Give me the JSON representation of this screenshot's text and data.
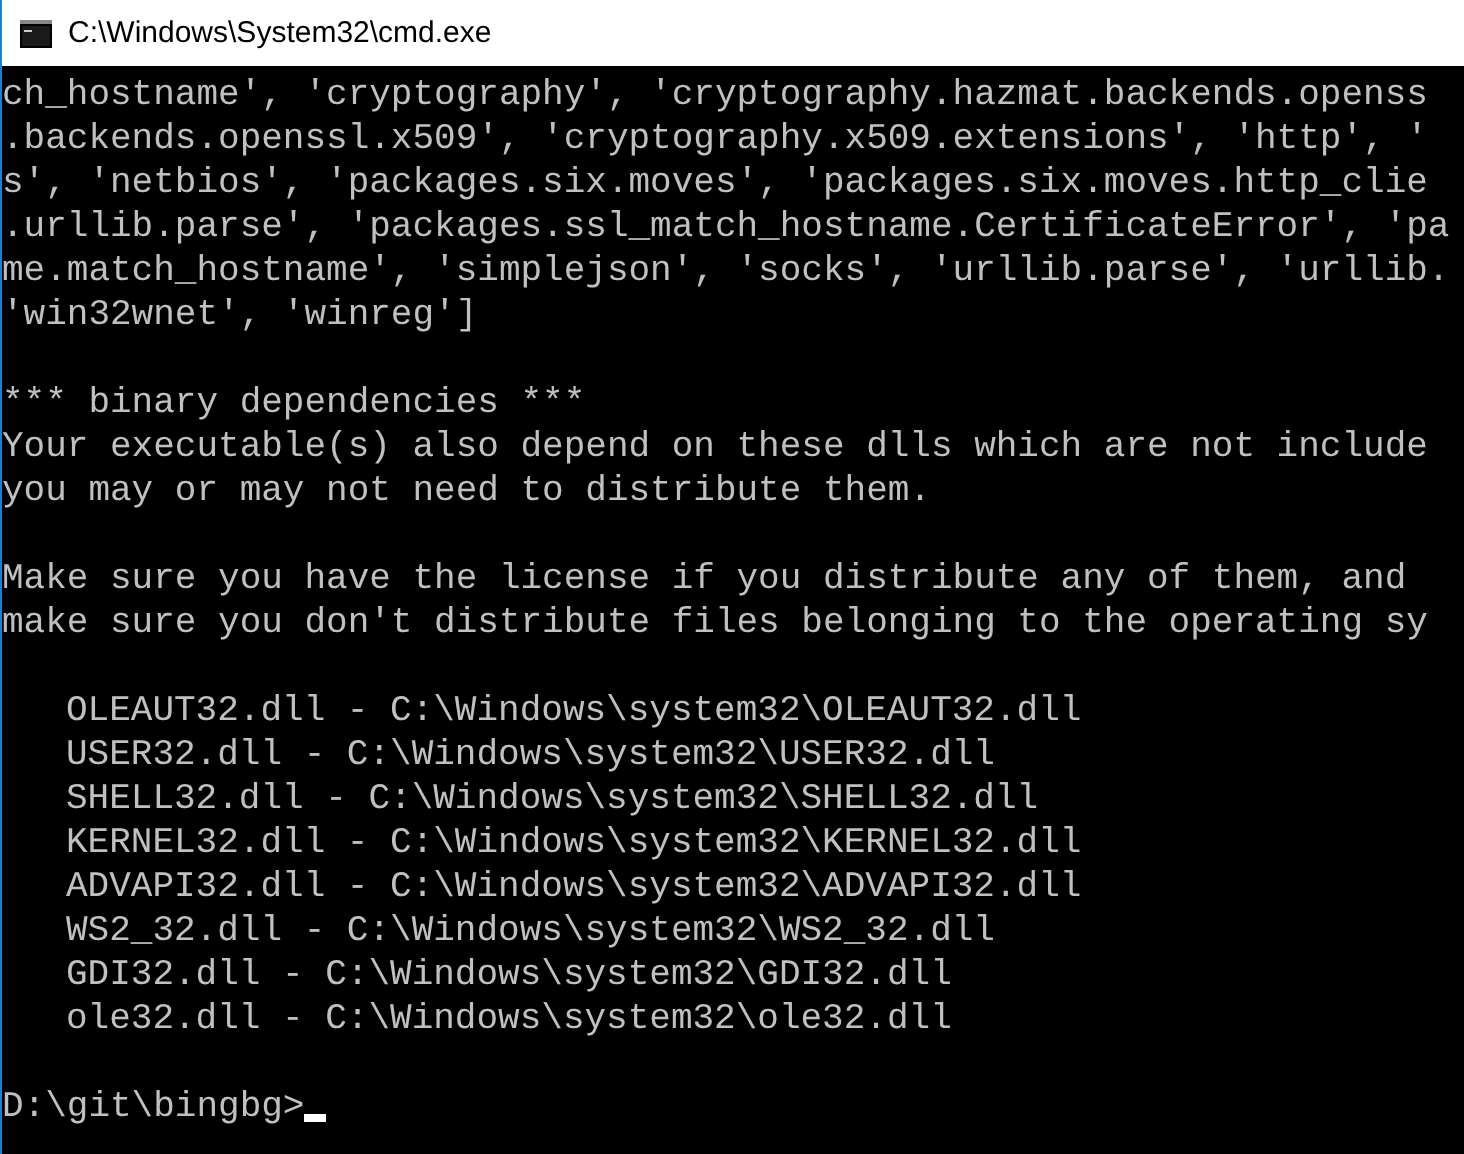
{
  "window": {
    "title": "C:\\Windows\\System32\\cmd.exe"
  },
  "console": {
    "blocks": [
      {
        "indent": false,
        "lines": [
          "ch_hostname', 'cryptography', 'cryptography.hazmat.backends.openss",
          ".backends.openssl.x509', 'cryptography.x509.extensions', 'http', '",
          "s', 'netbios', 'packages.six.moves', 'packages.six.moves.http_clie",
          ".urllib.parse', 'packages.ssl_match_hostname.CertificateError', 'pa",
          "me.match_hostname', 'simplejson', 'socks', 'urllib.parse', 'urllib.",
          "'win32wnet', 'winreg']"
        ]
      },
      {
        "indent": false,
        "lines": [
          "*** binary dependencies ***",
          "Your executable(s) also depend on these dlls which are not include",
          "you may or may not need to distribute them."
        ]
      },
      {
        "indent": false,
        "lines": [
          "Make sure you have the license if you distribute any of them, and",
          "make sure you don't distribute files belonging to the operating sy"
        ]
      },
      {
        "indent": true,
        "lines": [
          "OLEAUT32.dll - C:\\Windows\\system32\\OLEAUT32.dll",
          "USER32.dll - C:\\Windows\\system32\\USER32.dll",
          "SHELL32.dll - C:\\Windows\\system32\\SHELL32.dll",
          "KERNEL32.dll - C:\\Windows\\system32\\KERNEL32.dll",
          "ADVAPI32.dll - C:\\Windows\\system32\\ADVAPI32.dll",
          "WS2_32.dll - C:\\Windows\\system32\\WS2_32.dll",
          "GDI32.dll - C:\\Windows\\system32\\GDI32.dll",
          "ole32.dll - C:\\Windows\\system32\\ole32.dll"
        ]
      }
    ],
    "prompt": "D:\\git\\bingbg>"
  }
}
